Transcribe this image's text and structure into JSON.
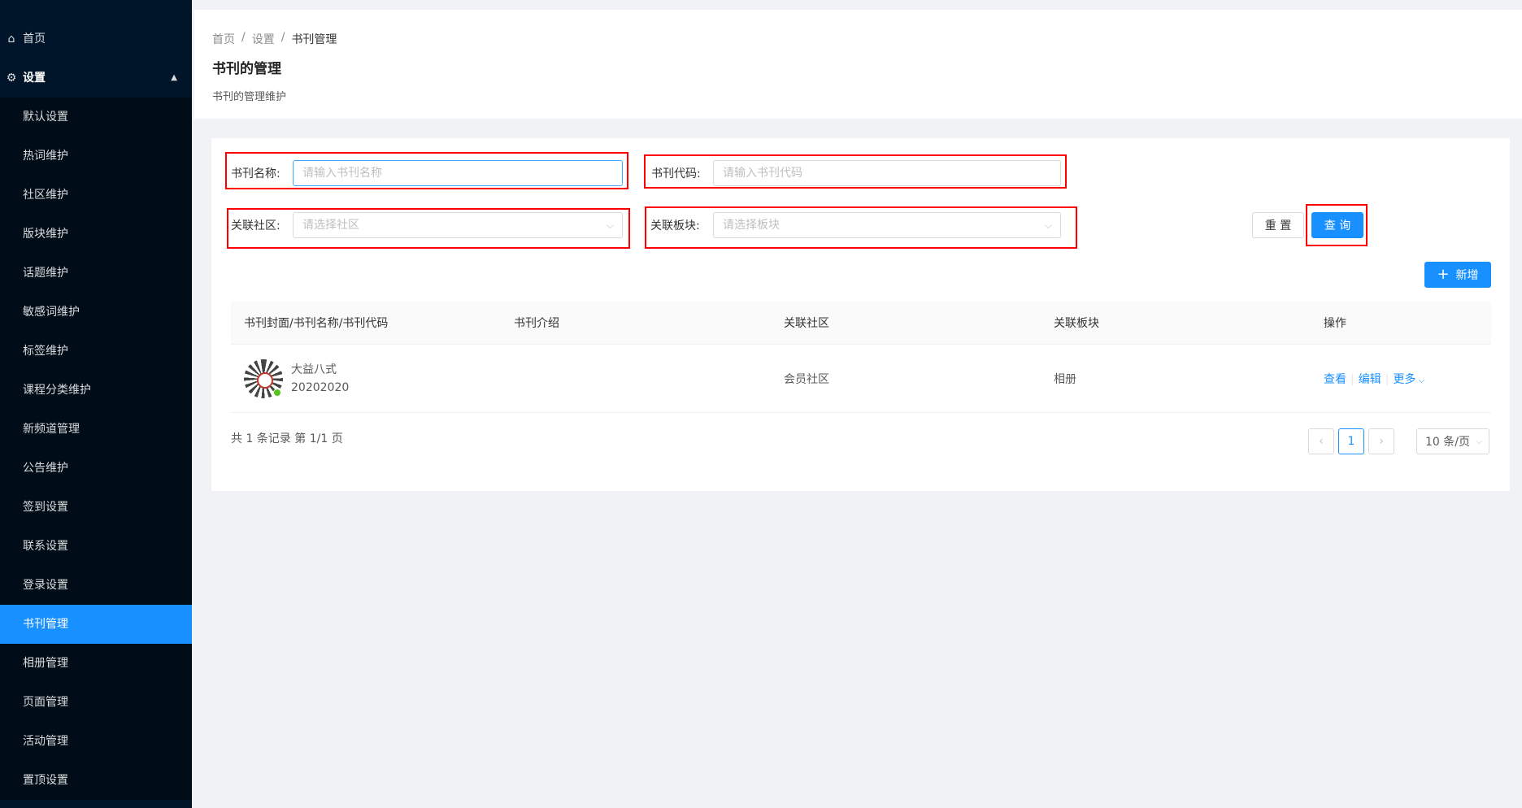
{
  "sidebar": {
    "home": "首页",
    "settings": "设置",
    "items": [
      {
        "label": "默认设置"
      },
      {
        "label": "热词维护"
      },
      {
        "label": "社区维护"
      },
      {
        "label": "版块维护"
      },
      {
        "label": "话题维护"
      },
      {
        "label": "敏感词维护"
      },
      {
        "label": "标签维护"
      },
      {
        "label": "课程分类维护"
      },
      {
        "label": "新频道管理"
      },
      {
        "label": "公告维护"
      },
      {
        "label": "签到设置"
      },
      {
        "label": "联系设置"
      },
      {
        "label": "登录设置"
      },
      {
        "label": "书刊管理"
      },
      {
        "label": "相册管理"
      },
      {
        "label": "页面管理"
      },
      {
        "label": "活动管理"
      },
      {
        "label": "置顶设置"
      }
    ],
    "active_index": 13
  },
  "breadcrumb": {
    "home": "首页",
    "sep1": "/",
    "settings": "设置",
    "sep2": "/",
    "current": "书刊管理"
  },
  "header": {
    "title": "书刊的管理",
    "desc": "书刊的管理维护"
  },
  "filters": {
    "name_label": "书刊名称:",
    "name_placeholder": "请输入书刊名称",
    "code_label": "书刊代码:",
    "code_placeholder": "请输入书刊代码",
    "community_label": "关联社区:",
    "community_placeholder": "请选择社区",
    "block_label": "关联板块:",
    "block_placeholder": "请选择板块",
    "reset": "重 置",
    "query": "查 询",
    "add": "新增"
  },
  "table": {
    "headers": [
      "书刊封面/书刊名称/书刊代码",
      "书刊介绍",
      "关联社区",
      "关联板块",
      "操作"
    ],
    "rows": [
      {
        "name": "大益八式",
        "code": "20202020",
        "intro": "",
        "community": "会员社区",
        "block": "相册",
        "actions": {
          "view": "查看",
          "edit": "编辑",
          "more": "更多"
        }
      }
    ]
  },
  "pagination": {
    "summary": "共 1 条记录 第 1/1 页",
    "current": "1",
    "page_size": "10 条/页"
  }
}
